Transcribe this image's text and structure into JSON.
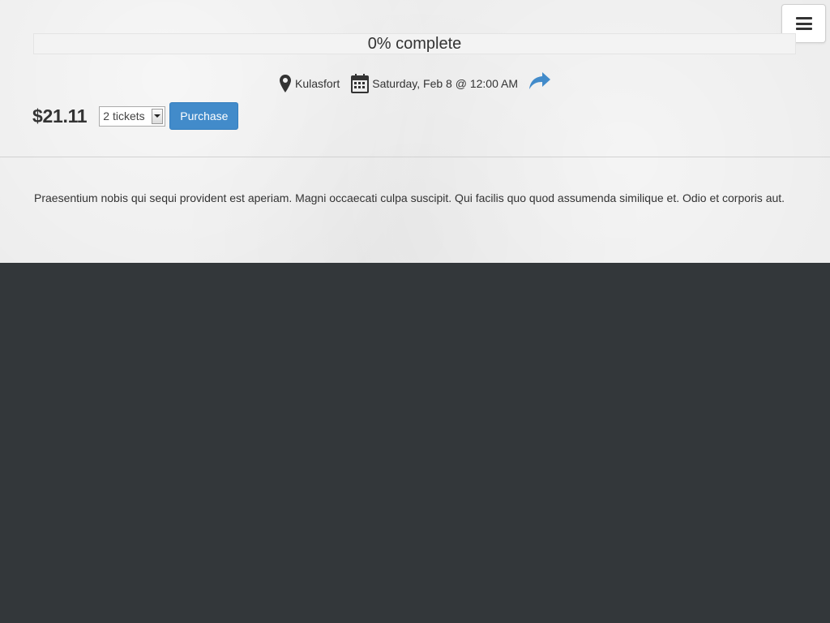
{
  "header": {
    "menu_icon": "hamburger-menu-icon"
  },
  "progress": {
    "label": "0% complete",
    "value_percent": 0
  },
  "event": {
    "location": "Kulasfort",
    "location_icon": "map-marker-icon",
    "date": "Saturday, Feb 8 @ 12:00 AM",
    "date_icon": "calendar-icon",
    "share_icon": "share-arrow-icon"
  },
  "purchase": {
    "price": "$21.11",
    "ticket_quantity": "2 tickets",
    "button_label": "Purchase"
  },
  "description": "Praesentium nobis qui sequi provident est aperiam. Magni occaecati culpa suscipit. Qui facilis quo quod assumenda similique et. Odio et corporis aut.",
  "colors": {
    "accent": "#428bca",
    "footer_background": "#33373a",
    "panel_background": "#ececec"
  }
}
